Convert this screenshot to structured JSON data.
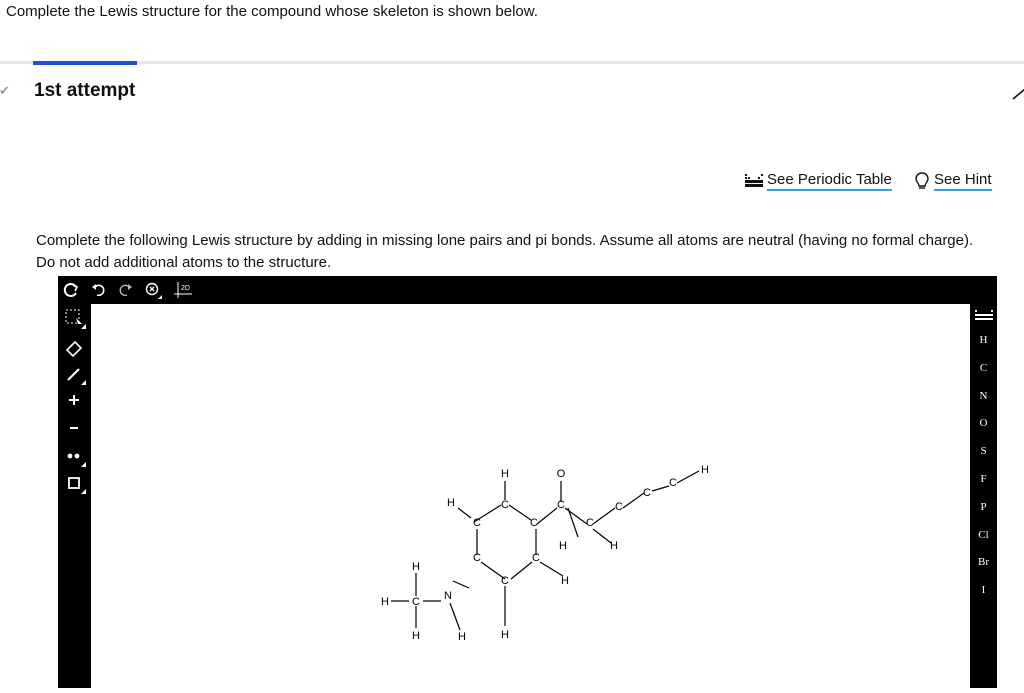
{
  "question": {
    "title": "Complete the Lewis structure for the compound whose skeleton is shown below."
  },
  "attempt": {
    "label": "1st attempt",
    "check_icon": "checkmark-icon",
    "edit_icon": "pencil-icon"
  },
  "resources": {
    "periodic_table": {
      "label": "See Periodic Table",
      "icon": "periodic-table-icon"
    },
    "hint": {
      "label": "See Hint",
      "icon": "lightbulb-icon"
    }
  },
  "instructions": "Complete the following Lewis structure by adding in missing lone pairs and pi bonds. Assume all atoms are neutral (having no formal charge). Do not add additional atoms to the structure.",
  "editor": {
    "top_tools": [
      "clear-icon",
      "undo-icon",
      "redo-icon",
      "zoom-icon",
      "2d-clean-icon"
    ],
    "top_tool_text": {
      "clean": "2D"
    },
    "left_tools": [
      "select-icon",
      "eraser-icon",
      "bond-icon",
      "plus-charge-icon",
      "minus-charge-icon",
      "lone-pair-icon",
      "bracket-icon"
    ],
    "elements": [
      "H",
      "C",
      "N",
      "O",
      "S",
      "F",
      "P",
      "Cl",
      "Br",
      "I"
    ],
    "molecule": {
      "atoms": {
        "h_top": "H",
        "o_top": "O",
        "h_right": "H",
        "h_ring_left": "H",
        "c_ring_tl": "C",
        "c_ring_top": "C",
        "c_ring_tr": "C",
        "c_carbonyl": "C",
        "c_chain1": "C",
        "c_chain2": "C",
        "c_chain3": "C",
        "h_me_top": "H",
        "h_ring_r": "H",
        "h_chain": "H",
        "c_methyl": "C",
        "n": "N",
        "h_me_left": "H",
        "c_ring_bl": "C",
        "c_ring_br": "C",
        "c_ring_bot": "C",
        "h_ring_br": "H",
        "h_me_bot": "H",
        "h_n": "H",
        "h_ring_bot": "H"
      }
    }
  },
  "colors": {
    "accent_blue": "#1f4fd1",
    "link_underline": "#39a0d6",
    "editor_bg": "#000000"
  }
}
